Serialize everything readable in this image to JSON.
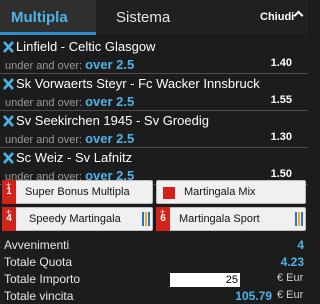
{
  "tabs": {
    "active": "Multipla",
    "other": "Sistema",
    "close": "Chiudi"
  },
  "bets": [
    {
      "match": "Linfield - Celtic Glasgow",
      "market": "under and over:",
      "selection": "over 2.5",
      "odd": "1.40"
    },
    {
      "match": "Sk Vorwaerts Steyr - Fc Wacker Innsbruck",
      "market": "under and over:",
      "selection": "over 2.5",
      "odd": "1.55"
    },
    {
      "match": "Sv Seekirchen 1945 - Sv Groedig",
      "market": "under and over:",
      "selection": "over 2.5",
      "odd": "1.30"
    },
    {
      "match": "Sc Weiz - Sv Lafnitz",
      "market": "under and over:",
      "selection": "over 2.5",
      "odd": "1.50"
    }
  ],
  "bonus": {
    "super_bonus": {
      "num": "1",
      "label": "Super Bonus Multipla"
    },
    "martingala_mix": {
      "label": "Martingala Mix"
    },
    "speedy": {
      "num": "4",
      "label": "Speedy Martingala"
    },
    "sport": {
      "num": "6",
      "label": "Martingala Sport"
    }
  },
  "summary": {
    "avvenimenti_label": "Avvenimenti",
    "avvenimenti": "4",
    "quota_label": "Totale Quota",
    "quota": "4.23",
    "importo_label": "Totale Importo",
    "importo": "25",
    "currency": "€ Eur",
    "vincita_label": "Totale vincita",
    "vincita": "105.79"
  },
  "colors": {
    "accent": "#4fb3e8",
    "badge_red": "#d1231a",
    "tab_underline": "#2d8fd2"
  },
  "icons": {
    "remove": "x-icon",
    "close": "chevron-up-icon"
  }
}
